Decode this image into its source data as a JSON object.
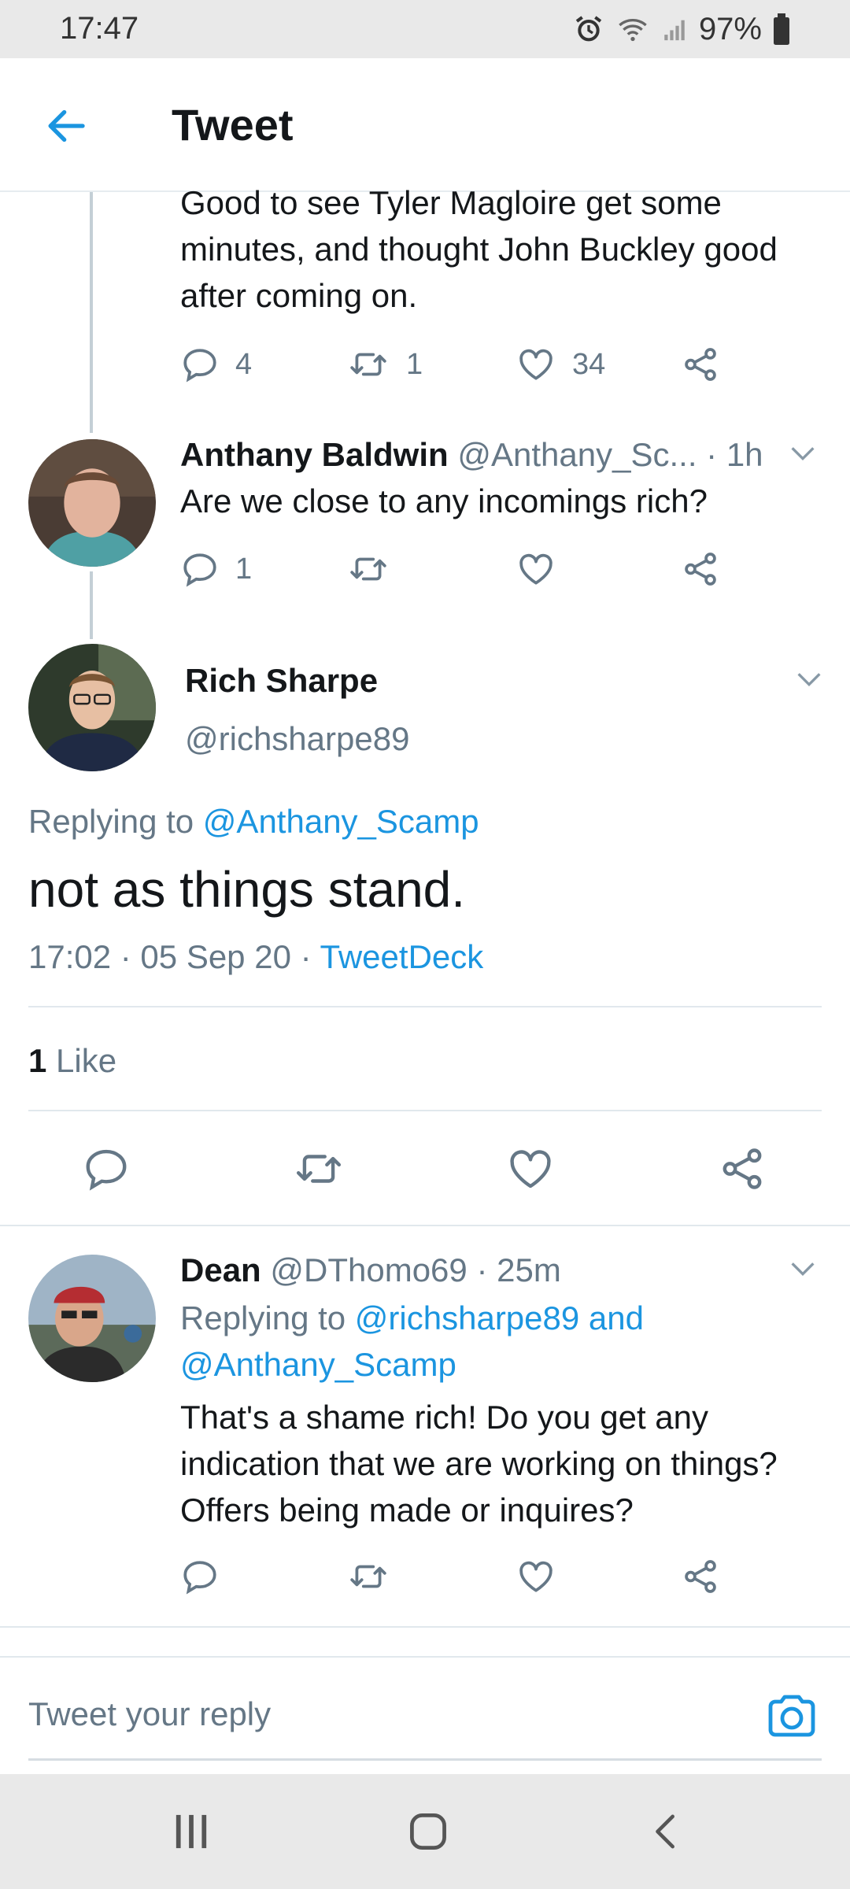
{
  "status_bar": {
    "time": "17:47",
    "battery": "97%",
    "icons": [
      "alarm-icon",
      "wifi-icon",
      "signal-icon",
      "battery-icon"
    ]
  },
  "header": {
    "title": "Tweet",
    "back_icon": "arrow-left-icon"
  },
  "tweet_top": {
    "text": "Good to see Tyler Magloire get some minutes, and thought John Buckley good after coming on.",
    "replies": "4",
    "retweets": "1",
    "likes": "34"
  },
  "tweet_anthany": {
    "name": "Anthany Baldwin",
    "handle": "@Anthany_Sc...",
    "time": "· 1h",
    "text": "Are we close to any incomings rich?",
    "replies": "1"
  },
  "main_tweet": {
    "name": "Rich Sharpe",
    "handle": "@richsharpe89",
    "replying_prefix": "Replying to",
    "replying_to": "@Anthany_Scamp",
    "text": "not as things stand.",
    "datetime": "17:02 · 05 Sep 20 ·",
    "source": "TweetDeck",
    "likes_count": "1",
    "likes_label": "Like"
  },
  "reply_dean": {
    "name": "Dean",
    "handle": "@DThomo69",
    "time": "· 25m",
    "replying_prefix": "Replying to",
    "replying_to_1": "@richsharpe89 and",
    "replying_to_2": "@Anthany_Scamp",
    "text": "That's a shame rich! Do you get any indication that we are working on things? Offers being made or inquires?"
  },
  "composer": {
    "placeholder": "Tweet your reply",
    "camera_icon": "camera-icon"
  },
  "colors": {
    "accent": "#1b95e0",
    "text_secondary": "#657786",
    "divider": "#e1e8ed"
  }
}
